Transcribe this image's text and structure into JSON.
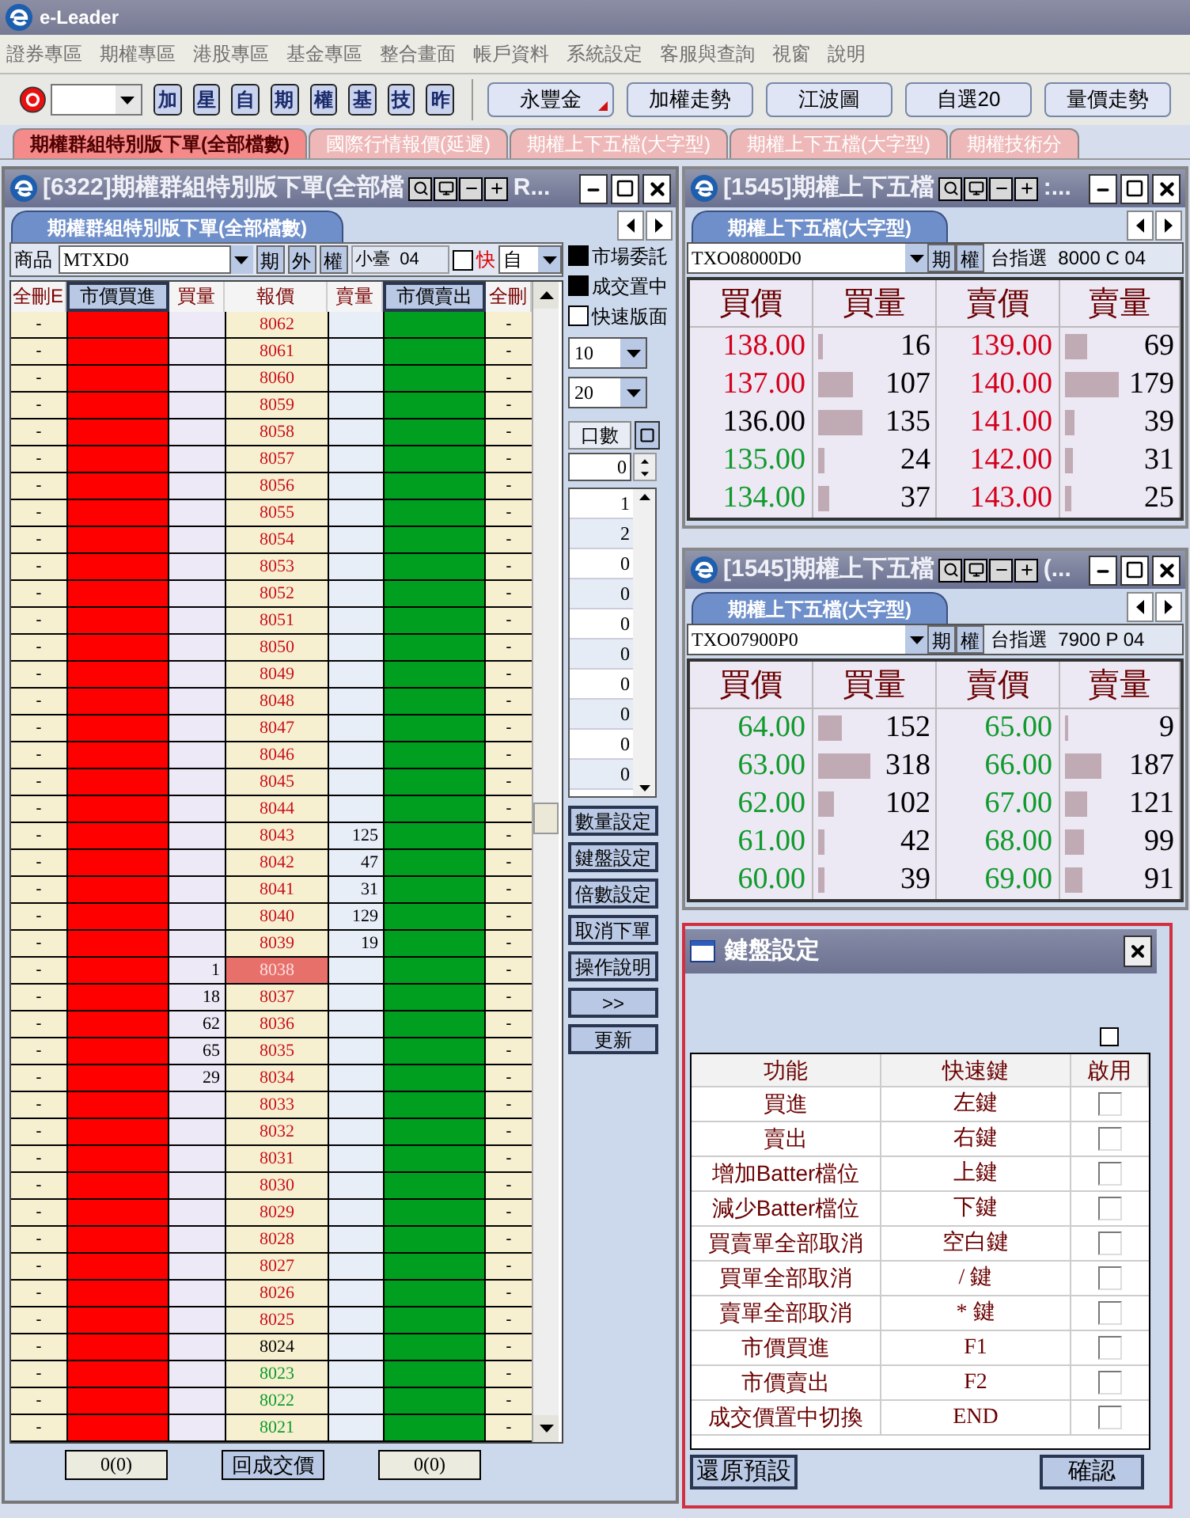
{
  "app": {
    "title": "e-Leader"
  },
  "menu": [
    "證券專區",
    "期權專區",
    "港股專區",
    "基金專區",
    "整合畫面",
    "帳戶資料",
    "系統設定",
    "客服與查詢",
    "視窗",
    "說明"
  ],
  "toolbar": {
    "quick_buttons": [
      "加",
      "星",
      "自",
      "期",
      "權",
      "基",
      "技",
      "昨"
    ],
    "buttons": [
      {
        "label": "永豐金",
        "has_menu": true
      },
      {
        "label": "加權走勢",
        "has_menu": false
      },
      {
        "label": "江波圖",
        "has_menu": false
      },
      {
        "label": "自選20",
        "has_menu": false
      },
      {
        "label": "量價走勢",
        "has_menu": false
      }
    ]
  },
  "tabs": [
    {
      "label": "期權群組特別版下單(全部檔數)",
      "selected": true
    },
    {
      "label": "國際行情報價(延遲)",
      "selected": false
    },
    {
      "label": "期權上下五檔(大字型)",
      "selected": false
    },
    {
      "label": "期權上下五檔(大字型)",
      "selected": false
    },
    {
      "label": "期權技術分",
      "selected": false
    }
  ],
  "order_window": {
    "title": "[6322]期權群組特別版下單(全部檔",
    "title_tail": "R...",
    "tab": "期權群組特別版下單(全部檔數)",
    "product_label": "商品",
    "product": "MTXD0",
    "type_buttons": [
      "期",
      "外",
      "權"
    ],
    "product_name": "小臺  04",
    "fast_check": {
      "label": "快",
      "checked": false
    },
    "mode": "自",
    "options": [
      {
        "label": "市場委託",
        "checked": true
      },
      {
        "label": "成交置中",
        "checked": true
      },
      {
        "label": "快速版面",
        "checked": false
      }
    ],
    "select_1": "10",
    "select_2": "20",
    "lots_label": "口數",
    "lots_value": "0",
    "lots_list": [
      "1",
      "2",
      "0",
      "0",
      "0",
      "0",
      "0",
      "0",
      "0",
      "0"
    ],
    "side_buttons": [
      "數量設定",
      "鍵盤設定",
      "倍數設定",
      "取消下單",
      "操作說明",
      ">>",
      "更新"
    ],
    "columns": [
      {
        "label": "全刪E",
        "kind": "label"
      },
      {
        "label": "市價買進",
        "kind": "button"
      },
      {
        "label": "買量",
        "kind": "label"
      },
      {
        "label": "報價",
        "kind": "label"
      },
      {
        "label": "賣量",
        "kind": "label"
      },
      {
        "label": "市價賣出",
        "kind": "button"
      },
      {
        "label": "全刪",
        "kind": "label"
      }
    ],
    "rows": [
      {
        "left": "-",
        "price": "8062",
        "color": "#c8101c",
        "current": false,
        "right": "-"
      },
      {
        "left": "-",
        "price": "8061",
        "color": "#c8101c",
        "current": false,
        "right": "-"
      },
      {
        "left": "-",
        "price": "8060",
        "color": "#c8101c",
        "current": false,
        "right": "-"
      },
      {
        "left": "-",
        "price": "8059",
        "color": "#c8101c",
        "current": false,
        "right": "-"
      },
      {
        "left": "-",
        "price": "8058",
        "color": "#c8101c",
        "current": false,
        "right": "-"
      },
      {
        "left": "-",
        "price": "8057",
        "color": "#c8101c",
        "current": false,
        "right": "-"
      },
      {
        "left": "-",
        "price": "8056",
        "color": "#c8101c",
        "current": false,
        "right": "-"
      },
      {
        "left": "-",
        "price": "8055",
        "color": "#c8101c",
        "current": false,
        "right": "-"
      },
      {
        "left": "-",
        "price": "8054",
        "color": "#c8101c",
        "current": false,
        "right": "-"
      },
      {
        "left": "-",
        "price": "8053",
        "color": "#c8101c",
        "current": false,
        "right": "-"
      },
      {
        "left": "-",
        "price": "8052",
        "color": "#c8101c",
        "current": false,
        "right": "-"
      },
      {
        "left": "-",
        "price": "8051",
        "color": "#c8101c",
        "current": false,
        "right": "-"
      },
      {
        "left": "-",
        "price": "8050",
        "color": "#c8101c",
        "current": false,
        "right": "-"
      },
      {
        "left": "-",
        "price": "8049",
        "color": "#c8101c",
        "current": false,
        "right": "-"
      },
      {
        "left": "-",
        "price": "8048",
        "color": "#c8101c",
        "current": false,
        "right": "-"
      },
      {
        "left": "-",
        "price": "8047",
        "color": "#c8101c",
        "current": false,
        "right": "-"
      },
      {
        "left": "-",
        "price": "8046",
        "color": "#c8101c",
        "current": false,
        "right": "-"
      },
      {
        "left": "-",
        "price": "8045",
        "color": "#c8101c",
        "current": false,
        "right": "-"
      },
      {
        "left": "-",
        "price": "8044",
        "color": "#c8101c",
        "current": false,
        "right": "-"
      },
      {
        "left": "-",
        "price": "8043",
        "color": "#c8101c",
        "current": false,
        "ask_qty": "125",
        "right": "-"
      },
      {
        "left": "-",
        "price": "8042",
        "color": "#c8101c",
        "current": false,
        "ask_qty": "47",
        "right": "-"
      },
      {
        "left": "-",
        "price": "8041",
        "color": "#c8101c",
        "current": false,
        "ask_qty": "31",
        "right": "-"
      },
      {
        "left": "-",
        "price": "8040",
        "color": "#c8101c",
        "current": false,
        "ask_qty": "129",
        "right": "-"
      },
      {
        "left": "-",
        "price": "8039",
        "color": "#c8101c",
        "current": false,
        "ask_qty": "19",
        "right": "-"
      },
      {
        "left": "-",
        "bid_qty": "1",
        "price": "8038",
        "current": true,
        "right": "-"
      },
      {
        "left": "-",
        "bid_qty": "18",
        "price": "8037",
        "color": "#c8101c",
        "current": false,
        "right": "-"
      },
      {
        "left": "-",
        "bid_qty": "62",
        "price": "8036",
        "color": "#c8101c",
        "current": false,
        "right": "-"
      },
      {
        "left": "-",
        "bid_qty": "65",
        "price": "8035",
        "color": "#c8101c",
        "current": false,
        "right": "-"
      },
      {
        "left": "-",
        "bid_qty": "29",
        "price": "8034",
        "color": "#c8101c",
        "current": false,
        "right": "-"
      },
      {
        "left": "-",
        "price": "8033",
        "color": "#c8101c",
        "current": false,
        "right": "-"
      },
      {
        "left": "-",
        "price": "8032",
        "color": "#c8101c",
        "current": false,
        "right": "-"
      },
      {
        "left": "-",
        "price": "8031",
        "color": "#c8101c",
        "current": false,
        "right": "-"
      },
      {
        "left": "-",
        "price": "8030",
        "color": "#c8101c",
        "current": false,
        "right": "-"
      },
      {
        "left": "-",
        "price": "8029",
        "color": "#c8101c",
        "current": false,
        "right": "-"
      },
      {
        "left": "-",
        "price": "8028",
        "color": "#c8101c",
        "current": false,
        "right": "-"
      },
      {
        "left": "-",
        "price": "8027",
        "color": "#c8101c",
        "current": false,
        "right": "-"
      },
      {
        "left": "-",
        "price": "8026",
        "color": "#c8101c",
        "current": false,
        "right": "-"
      },
      {
        "left": "-",
        "price": "8025",
        "color": "#c8101c",
        "current": false,
        "right": "-"
      },
      {
        "left": "-",
        "price": "8024",
        "color": "#000000",
        "current": false,
        "right": "-"
      },
      {
        "left": "-",
        "price": "8023",
        "color": "#109a2c",
        "current": false,
        "right": "-"
      },
      {
        "left": "-",
        "price": "8022",
        "color": "#109a2c",
        "current": false,
        "right": "-"
      },
      {
        "left": "-",
        "price": "8021",
        "color": "#109a2c",
        "current": false,
        "right": "-"
      }
    ],
    "bottom": {
      "buy_total": "0(0)",
      "center_button": "回成交價",
      "sell_total": "0(0)"
    }
  },
  "quote_windows": [
    {
      "title": "[1545]期權上下五檔",
      "title_tail": ":...",
      "tab": "期權上下五檔(大字型)",
      "symbol": "TXO08000D0",
      "type_buttons": [
        "期",
        "權"
      ],
      "name": "台指選  8000 C 04",
      "columns": [
        "買價",
        "買量",
        "賣價",
        "賣量"
      ],
      "rows": [
        {
          "bid": {
            "price": "138.00",
            "color": "#d4001c",
            "qty": "16",
            "level": 0.04
          },
          "ask": {
            "price": "139.00",
            "color": "#d4001c",
            "qty": "69",
            "level": 0.19
          }
        },
        {
          "bid": {
            "price": "137.00",
            "color": "#d4001c",
            "qty": "107",
            "level": 0.3
          },
          "ask": {
            "price": "140.00",
            "color": "#d4001c",
            "qty": "179",
            "level": 0.47
          }
        },
        {
          "bid": {
            "price": "136.00",
            "color": "#000000",
            "qty": "135",
            "level": 0.38
          },
          "ask": {
            "price": "141.00",
            "color": "#d4001c",
            "qty": "39",
            "level": 0.08
          }
        },
        {
          "bid": {
            "price": "135.00",
            "color": "#109a2c",
            "qty": "24",
            "level": 0.06
          },
          "ask": {
            "price": "142.00",
            "color": "#d4001c",
            "qty": "31",
            "level": 0.07
          }
        },
        {
          "bid": {
            "price": "134.00",
            "color": "#109a2c",
            "qty": "37",
            "level": 0.1
          },
          "ask": {
            "price": "143.00",
            "color": "#d4001c",
            "qty": "25",
            "level": 0.06
          }
        }
      ]
    },
    {
      "title": "[1545]期權上下五檔",
      "title_tail": "(...",
      "tab": "期權上下五檔(大字型)",
      "symbol": "TXO07900P0",
      "type_buttons": [
        "期",
        "權"
      ],
      "name": "台指選  7900 P 04",
      "columns": [
        "買價",
        "買量",
        "賣價",
        "賣量"
      ],
      "rows": [
        {
          "bid": {
            "price": "64.00",
            "color": "#109a2c",
            "qty": "152",
            "level": 0.2
          },
          "ask": {
            "price": "65.00",
            "color": "#109a2c",
            "qty": "9",
            "level": 0.01
          }
        },
        {
          "bid": {
            "price": "63.00",
            "color": "#109a2c",
            "qty": "318",
            "level": 0.44
          },
          "ask": {
            "price": "66.00",
            "color": "#109a2c",
            "qty": "187",
            "level": 0.32
          }
        },
        {
          "bid": {
            "price": "62.00",
            "color": "#109a2c",
            "qty": "102",
            "level": 0.14
          },
          "ask": {
            "price": "67.00",
            "color": "#109a2c",
            "qty": "121",
            "level": 0.2
          }
        },
        {
          "bid": {
            "price": "61.00",
            "color": "#109a2c",
            "qty": "42",
            "level": 0.05
          },
          "ask": {
            "price": "68.00",
            "color": "#109a2c",
            "qty": "99",
            "level": 0.17
          }
        },
        {
          "bid": {
            "price": "60.00",
            "color": "#109a2c",
            "qty": "39",
            "level": 0.05
          },
          "ask": {
            "price": "69.00",
            "color": "#109a2c",
            "qty": "91",
            "level": 0.15
          }
        }
      ]
    }
  ],
  "dialog": {
    "title": "鍵盤設定",
    "select_all": {
      "checked": false
    },
    "columns": [
      "功能",
      "快速鍵",
      "啟用"
    ],
    "rows": [
      {
        "function": "買進",
        "key": "左鍵",
        "enabled": false
      },
      {
        "function": "賣出",
        "key": "右鍵",
        "enabled": false
      },
      {
        "function": "增加Batter檔位",
        "key": "上鍵",
        "enabled": false
      },
      {
        "function": "減少Batter檔位",
        "key": "下鍵",
        "enabled": false
      },
      {
        "function": "買賣單全部取消",
        "key": "空白鍵",
        "enabled": false
      },
      {
        "function": "買單全部取消",
        "key": "/ 鍵",
        "enabled": false
      },
      {
        "function": "賣單全部取消",
        "key": "* 鍵",
        "enabled": false
      },
      {
        "function": "市價買進",
        "key": "F1",
        "enabled": false
      },
      {
        "function": "市價賣出",
        "key": "F2",
        "enabled": false
      },
      {
        "function": "成交價置中切換",
        "key": "END",
        "enabled": false
      }
    ],
    "buttons": [
      "還原預設",
      "確認"
    ]
  }
}
